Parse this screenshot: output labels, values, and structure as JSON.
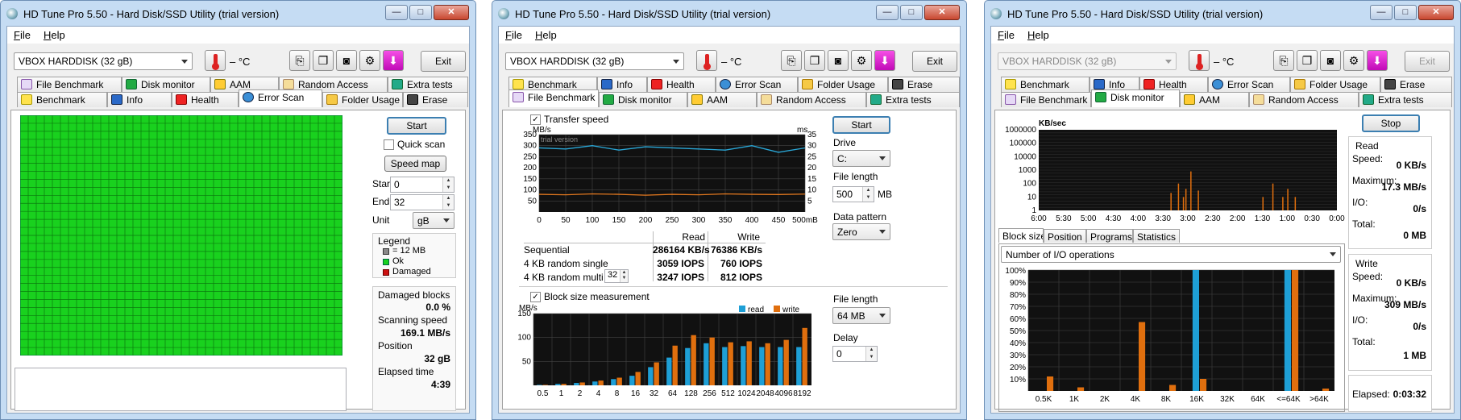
{
  "app_title": "HD Tune Pro 5.50 - Hard Disk/SSD Utility (trial version)",
  "window_buttons": {
    "minimize": "—",
    "maximize": "□",
    "close": "✕"
  },
  "menu": {
    "file": "File",
    "help": "Help"
  },
  "drive": "VBOX HARDDISK (32 gB)",
  "temperature": "– °C",
  "exit_label": "Exit",
  "icons": [
    "copy-info-icon",
    "copy-screenshot-icon",
    "camera-icon",
    "options-icon",
    "save-icon"
  ],
  "colors": {
    "chrome": "#c5dcf3",
    "read": "#1e9fd6",
    "write": "#e06f0e",
    "scan_ok": "#19d11e",
    "trace_read": "#2aa8d8",
    "trace_write": "#e2781f"
  },
  "tabs_row_a": [
    "File Benchmark",
    "Disk monitor",
    "AAM",
    "Random Access",
    "Extra tests"
  ],
  "tabs_row_b": [
    "Benchmark",
    "Info",
    "Health",
    "Error Scan",
    "Folder Usage",
    "Erase"
  ],
  "error_scan": {
    "start_label": "Start",
    "quick_scan": "Quick scan",
    "speed_map": "Speed map",
    "start_lbl": "Start",
    "start_val": "0",
    "end_lbl": "End",
    "end_val": "32",
    "unit_lbl": "Unit",
    "unit_val": "gB",
    "legend_title": "Legend",
    "legend_block": "= 12 MB",
    "legend_ok": "Ok",
    "legend_damaged": "Damaged",
    "damaged_lbl": "Damaged blocks",
    "damaged_val": "0.0 %",
    "speed_lbl": "Scanning speed",
    "speed_val": "169.1 MB/s",
    "position_lbl": "Position",
    "position_val": "32 gB",
    "elapsed_lbl": "Elapsed time",
    "elapsed_val": "4:39"
  },
  "file_benchmark": {
    "transfer_speed": "Transfer speed",
    "trial_text": "trial version",
    "unit_left": "MB/s",
    "unit_right": "ms",
    "start_label": "Start",
    "drive_lbl": "Drive",
    "drive_val": "C:",
    "file_length_lbl": "File length",
    "file_length_val": "500",
    "file_length_unit": "MB",
    "data_pattern_lbl": "Data pattern",
    "data_pattern_val": "Zero",
    "table_headers": [
      "",
      "Read",
      "Write"
    ],
    "rows": [
      {
        "label": "Sequential",
        "read": "286164 KB/s",
        "write": "76386 KB/s"
      },
      {
        "label": "4 KB random single",
        "read": "3059 IOPS",
        "write": "760 IOPS"
      },
      {
        "label": "4 KB random multi",
        "read": "3247 IOPS",
        "write": "812 IOPS"
      }
    ],
    "queue_depth": "32",
    "block_size_measurement": "Block size measurement",
    "block_unit": "MB/s",
    "legend_read": "read",
    "legend_write": "write",
    "file_length2_lbl": "File length",
    "file_length2_val": "64 MB",
    "delay_lbl": "Delay",
    "delay_val": "0"
  },
  "disk_monitor": {
    "stop_label": "Stop",
    "unit": "KB/sec",
    "read_title": "Read",
    "read_speed_lbl": "Speed:",
    "read_speed_val": "0 KB/s",
    "read_max_lbl": "Maximum:",
    "read_max_val": "17.3 MB/s",
    "read_io_lbl": "I/O:",
    "read_io_val": "0/s",
    "read_total_lbl": "Total:",
    "read_total_val": "0 MB",
    "write_title": "Write",
    "write_speed_lbl": "Speed:",
    "write_speed_val": "0 KB/s",
    "write_max_lbl": "Maximum:",
    "write_max_val": "309 MB/s",
    "write_io_lbl": "I/O:",
    "write_io_val": "0/s",
    "write_total_lbl": "Total:",
    "write_total_val": "1 MB",
    "elapsed_lbl": "Elapsed:",
    "elapsed_val": "0:03:32",
    "subtabs": [
      "Block size",
      "Position",
      "Programs",
      "Statistics"
    ],
    "metric": "Number of I/O operations"
  },
  "chart_data": [
    {
      "type": "line",
      "title": "Transfer speed",
      "ylabel": "MB/s",
      "y2label": "ms",
      "x": [
        0,
        50,
        100,
        150,
        200,
        250,
        300,
        350,
        400,
        450,
        500
      ],
      "x_tick_labels": [
        "0",
        "50",
        "100",
        "150",
        "200",
        "250",
        "300",
        "350",
        "400",
        "450",
        "500mB"
      ],
      "ylim": [
        0,
        350
      ],
      "y_ticks": [
        50,
        100,
        150,
        200,
        250,
        300,
        350
      ],
      "y2lim": [
        0,
        35
      ],
      "y2_ticks": [
        5,
        10,
        15,
        20,
        25,
        30,
        35
      ],
      "series": [
        {
          "name": "read",
          "values": [
            290,
            285,
            300,
            280,
            295,
            290,
            285,
            280,
            300,
            270,
            290
          ]
        },
        {
          "name": "write",
          "values": [
            80,
            78,
            82,
            80,
            76,
            80,
            78,
            82,
            80,
            79,
            81
          ]
        }
      ]
    },
    {
      "type": "bar",
      "title": "Block size measurement",
      "ylabel": "MB/s",
      "ylim": [
        0,
        150
      ],
      "y_ticks": [
        50,
        100,
        150
      ],
      "categories": [
        "0.5",
        "1",
        "2",
        "4",
        "8",
        "16",
        "32",
        "64",
        "128",
        "256",
        "512",
        "1024",
        "2048",
        "4096",
        "8192"
      ],
      "series": [
        {
          "name": "read",
          "values": [
            1,
            3,
            5,
            8,
            13,
            20,
            38,
            58,
            78,
            88,
            80,
            82,
            80,
            80,
            80
          ]
        },
        {
          "name": "write",
          "values": [
            1,
            3,
            6,
            10,
            16,
            28,
            48,
            83,
            105,
            100,
            90,
            92,
            88,
            95,
            120
          ]
        }
      ]
    },
    {
      "type": "bar",
      "title": "Disk monitor",
      "ylabel": "KB/sec",
      "yscale": "log",
      "y_ticks": [
        "1",
        "10",
        "100",
        "1000",
        "10000",
        "100000",
        "1000000"
      ],
      "x_tick_labels": [
        "6:00",
        "5:30",
        "5:00",
        "4:30",
        "4:00",
        "3:30",
        "3:00",
        "2:30",
        "2:00",
        "1:30",
        "1:00",
        "0:30",
        "0:00"
      ],
      "series": [
        {
          "name": "write",
          "x_minutes": [
            3.35,
            3.2,
            3.1,
            3.05,
            2.95,
            2.8,
            1.5,
            1.3,
            1.1,
            1.0,
            0.85
          ],
          "values": [
            20,
            100,
            10,
            40,
            800,
            30,
            10,
            100,
            10,
            40,
            10
          ]
        }
      ]
    },
    {
      "type": "bar",
      "title": "Number of I/O operations",
      "ylabel": "%",
      "ylim": [
        0,
        100
      ],
      "y_ticks": [
        "10%",
        "20%",
        "30%",
        "40%",
        "50%",
        "60%",
        "70%",
        "80%",
        "90%",
        "100%"
      ],
      "categories": [
        "0.5K",
        "1K",
        "2K",
        "4K",
        "8K",
        "16K",
        "32K",
        "64K",
        "<=64K",
        ">64K"
      ],
      "series": [
        {
          "name": "read",
          "values": [
            0,
            0,
            0,
            0,
            0,
            100,
            0,
            0,
            100,
            0
          ]
        },
        {
          "name": "write",
          "values": [
            12,
            3,
            0,
            57,
            5,
            10,
            0,
            0,
            100,
            2
          ]
        }
      ]
    }
  ]
}
